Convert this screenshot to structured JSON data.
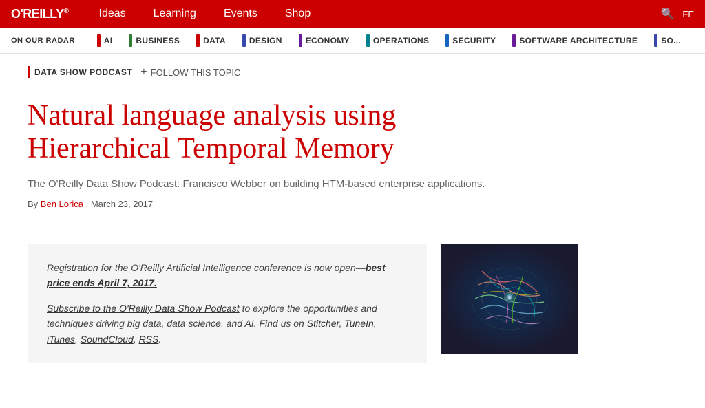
{
  "nav": {
    "logo": "O'REILLY",
    "logo_reg": "®",
    "links": [
      {
        "label": "Ideas",
        "id": "ideas"
      },
      {
        "label": "Learning",
        "id": "learning"
      },
      {
        "label": "Events",
        "id": "events"
      },
      {
        "label": "Shop",
        "id": "shop"
      }
    ]
  },
  "radar": {
    "label": "ON OUR RADAR",
    "topics": [
      {
        "label": "AI",
        "color": "#cc0000"
      },
      {
        "label": "BUSINESS",
        "color": "#2e7d32"
      },
      {
        "label": "DATA",
        "color": "#cc0000"
      },
      {
        "label": "DESIGN",
        "color": "#3949ab"
      },
      {
        "label": "ECONOMY",
        "color": "#6a1b9a"
      },
      {
        "label": "OPERATIONS",
        "color": "#00838f"
      },
      {
        "label": "SECURITY",
        "color": "#1565c0"
      },
      {
        "label": "SOFTWARE ARCHITECTURE",
        "color": "#6a1b9a"
      },
      {
        "label": "SO...",
        "color": "#3949ab"
      }
    ]
  },
  "breadcrumb": {
    "podcast_label": "DATA SHOW PODCAST",
    "follow_label": "FOLLOW THIS TOPIC"
  },
  "article": {
    "title": "Natural language analysis using Hierarchical Temporal Memory",
    "subtitle": "The O'Reilly Data Show Podcast: Francisco Webber on building HTM-based enterprise applications.",
    "byline_prefix": "By",
    "author": "Ben Lorica",
    "date": "March 23, 2017"
  },
  "callout": {
    "paragraph1_prefix": "Registration for the O'Reilly Artificial Intelligence conference is now open—",
    "paragraph1_link": "best price ends April 7, 2017.",
    "paragraph2_prefix": "",
    "paragraph2_link": "Subscribe to the O'Reilly Data Show Podcast",
    "paragraph2_suffix": " to explore the opportunities and techniques driving big data, data science, and AI. Find us on ",
    "links": [
      "Stitcher",
      "TuneIn",
      "iTunes",
      "SoundCloud",
      "RSS"
    ]
  }
}
